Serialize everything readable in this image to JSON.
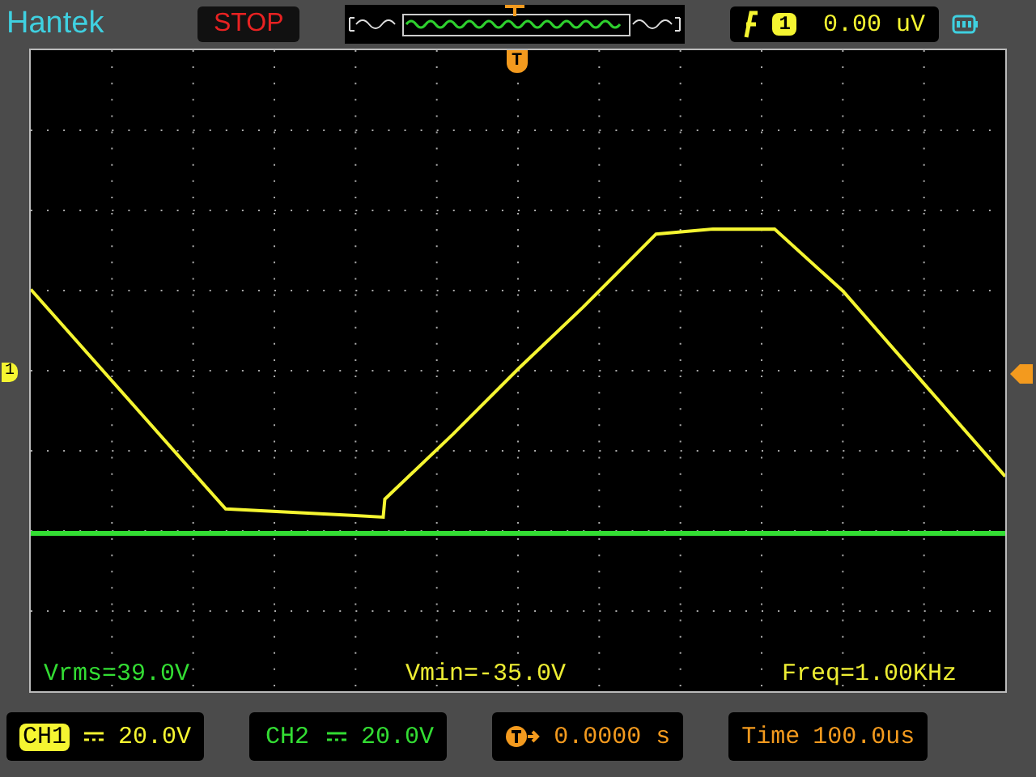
{
  "brand": "Hantek",
  "run_state": "STOP",
  "trigger_status": {
    "source": "1",
    "level": "0.00 uV"
  },
  "plot": {
    "trigger_marker": "T",
    "ch1_marker": "1",
    "measurements": [
      {
        "text": "Vrms=39.0V",
        "color": "#33dd33"
      },
      {
        "text": "Vmin=-35.0V",
        "color": "#eeee33"
      },
      {
        "text": "Freq=1.00KHz",
        "color": "#eeee33"
      }
    ]
  },
  "channels": [
    {
      "label": "CH1",
      "scale": "20.0V",
      "color": "#f5f531",
      "selected": true
    },
    {
      "label": "CH2",
      "scale": "20.0V",
      "color": "#33dd33",
      "selected": false
    }
  ],
  "trigger_position": "0.0000 s",
  "timebase": {
    "label": "Time",
    "value": "100.0us"
  }
}
